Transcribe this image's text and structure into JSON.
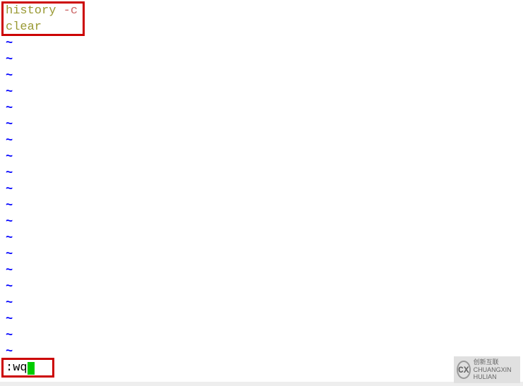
{
  "editor": {
    "lines": [
      {
        "type": "code",
        "parts": {
          "cmd": "history ",
          "flag": "-c"
        }
      },
      {
        "type": "code",
        "parts": {
          "cmd": "clear"
        }
      }
    ],
    "tilde_count": 20,
    "tilde_char": "~",
    "command_line": ":wq"
  },
  "watermark": {
    "icon_text": "CX",
    "line1": "创新互联",
    "line2": "CHUANGXIN HULIAN"
  }
}
